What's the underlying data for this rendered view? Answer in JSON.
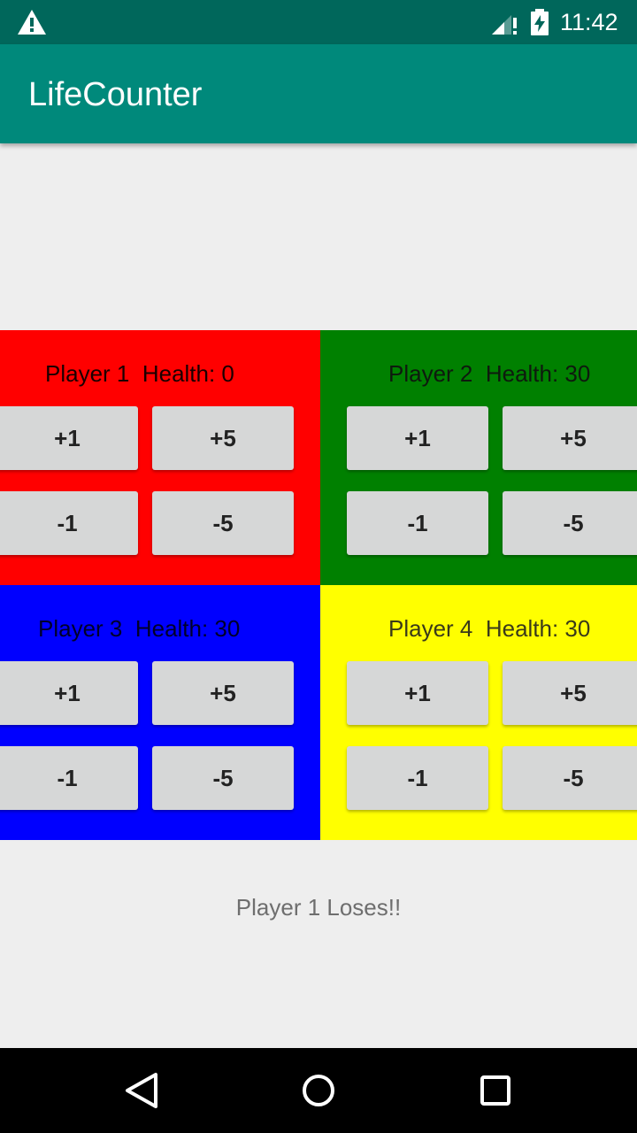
{
  "status_bar": {
    "time": "11:42",
    "icons": [
      "warning-icon",
      "signal-icon",
      "battery-charging-icon"
    ]
  },
  "app_bar": {
    "title": "LifeCounter"
  },
  "colors": {
    "status_bar": "#00675b",
    "app_bar": "#00897b",
    "player1": "#ff0000",
    "player2": "#008000",
    "player3": "#0000ff",
    "player4": "#ffff00",
    "button": "#d6d7d7"
  },
  "players": [
    {
      "label": "Player 1  Health: 0",
      "buttons": {
        "plus1": "+1",
        "plus5": "+5",
        "minus1": "-1",
        "minus5": "-5"
      }
    },
    {
      "label": "Player 2  Health: 30",
      "buttons": {
        "plus1": "+1",
        "plus5": "+5",
        "minus1": "-1",
        "minus5": "-5"
      }
    },
    {
      "label": "Player 3  Health: 30",
      "buttons": {
        "plus1": "+1",
        "plus5": "+5",
        "minus1": "-1",
        "minus5": "-5"
      }
    },
    {
      "label": "Player 4  Health: 30",
      "buttons": {
        "plus1": "+1",
        "plus5": "+5",
        "minus1": "-1",
        "minus5": "-5"
      }
    }
  ],
  "message": "Player 1 Loses!!",
  "nav_bar": {
    "icons": [
      "back-icon",
      "home-icon",
      "recents-icon"
    ]
  }
}
